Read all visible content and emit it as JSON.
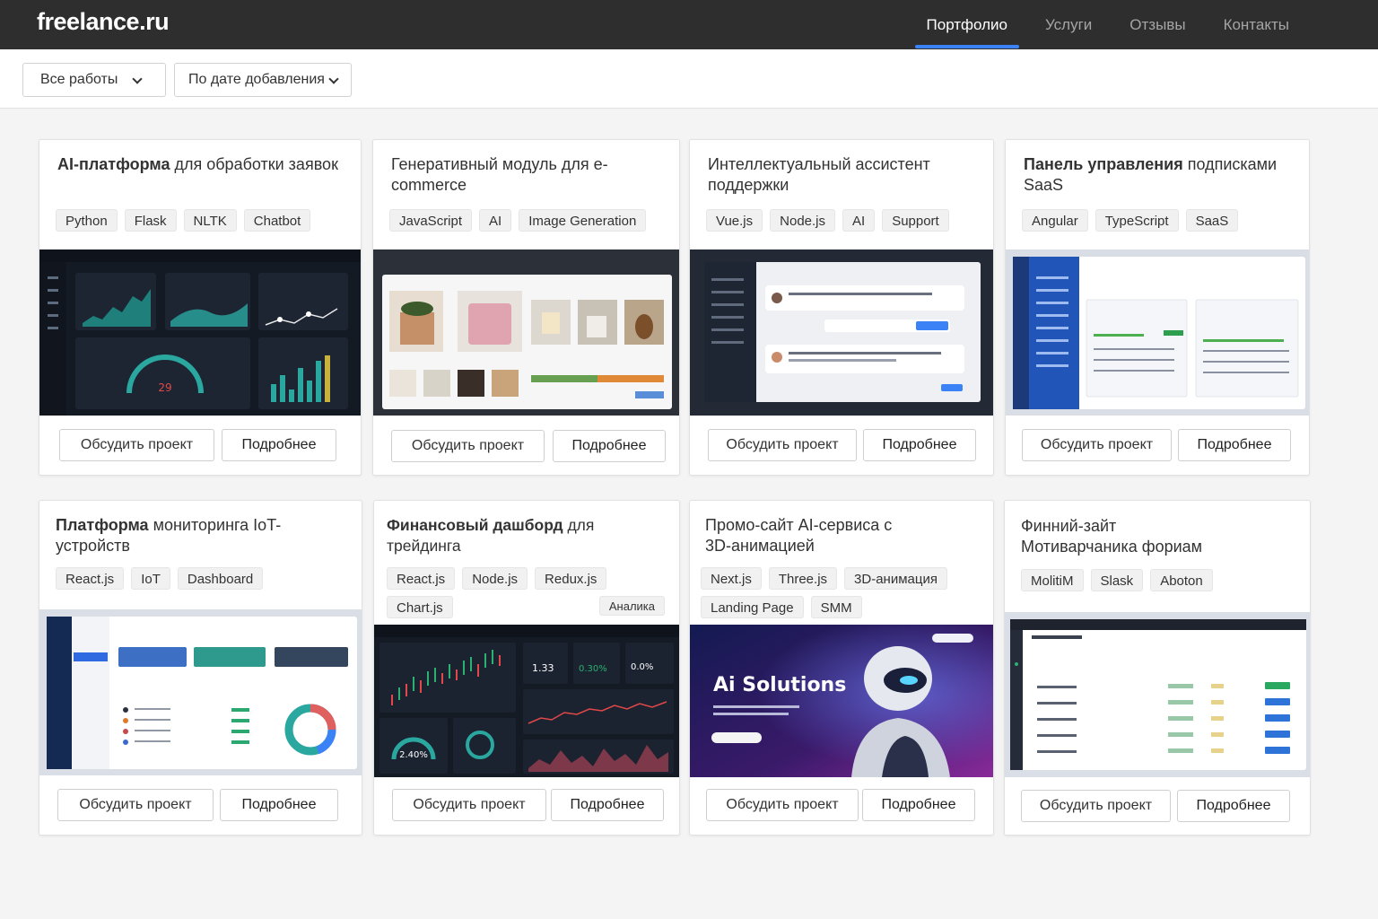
{
  "header": {
    "logo": "freelance",
    "logo_suffix": ".ru",
    "nav": [
      {
        "label": "Портфолио",
        "active": true
      },
      {
        "label": "Услуги",
        "active": false
      },
      {
        "label": "Отзывы",
        "active": false
      },
      {
        "label": "Контакты",
        "active": false
      }
    ]
  },
  "filters": {
    "category": "Все работы",
    "sort": "По дате добавления"
  },
  "colors": {
    "accent": "#3b82f6",
    "topbar": "#2e2e2e"
  },
  "buttons": {
    "discuss": "Обсудить проект",
    "details": "Подробнее"
  },
  "cards": [
    {
      "title_bold": "AI-платформа",
      "title_rest": " для обработки заявок",
      "tags": [
        "Python",
        "Flask",
        "NLTK",
        "Chatbot"
      ],
      "preview": {
        "value": "29"
      }
    },
    {
      "title_bold": "",
      "title_rest": "Генеративный модуль для e-commerce",
      "tags": [
        "JavaScript",
        "AI",
        "Image Generation"
      ]
    },
    {
      "title_bold": "",
      "title_rest": "Интеллектуальный ассистент поддержки",
      "tags": [
        "Vue.js",
        "Node.js",
        "AI",
        "Support"
      ]
    },
    {
      "title_bold": "Панель управления",
      "title_rest": " подписками SaaS",
      "tags": [
        "Angular",
        "TypeScript",
        "SaaS"
      ]
    },
    {
      "title_bold": "Платформа",
      "title_rest": " мониторинга IoT-устройств",
      "tags": [
        "React.js",
        "IoT",
        "Dashboard"
      ]
    },
    {
      "title_bold": "Финансовый дашборд",
      "title_rest": " для трейдинга",
      "tags": [
        "React.js",
        "Node.js",
        "Redux.js",
        "Chart.js",
        "Аналика"
      ],
      "preview": {
        "values": [
          "1.33",
          "0.30%",
          "0.0%"
        ],
        "gauge": "2.40%"
      }
    },
    {
      "title_bold": "",
      "title_rest": "Промо-сайт AI-сервиса с 3D-анимацией",
      "tags": [
        "Next.js",
        "Three.js",
        "3D-анимация",
        "Landing Page",
        "SMM"
      ],
      "preview": {
        "headline": "Ai Solutions"
      }
    },
    {
      "title_bold": "",
      "title_rest": "Финний-зайт Мотиварчаника фориам",
      "tags": [
        "MolitiM",
        "Slask",
        "Aboton"
      ]
    }
  ]
}
